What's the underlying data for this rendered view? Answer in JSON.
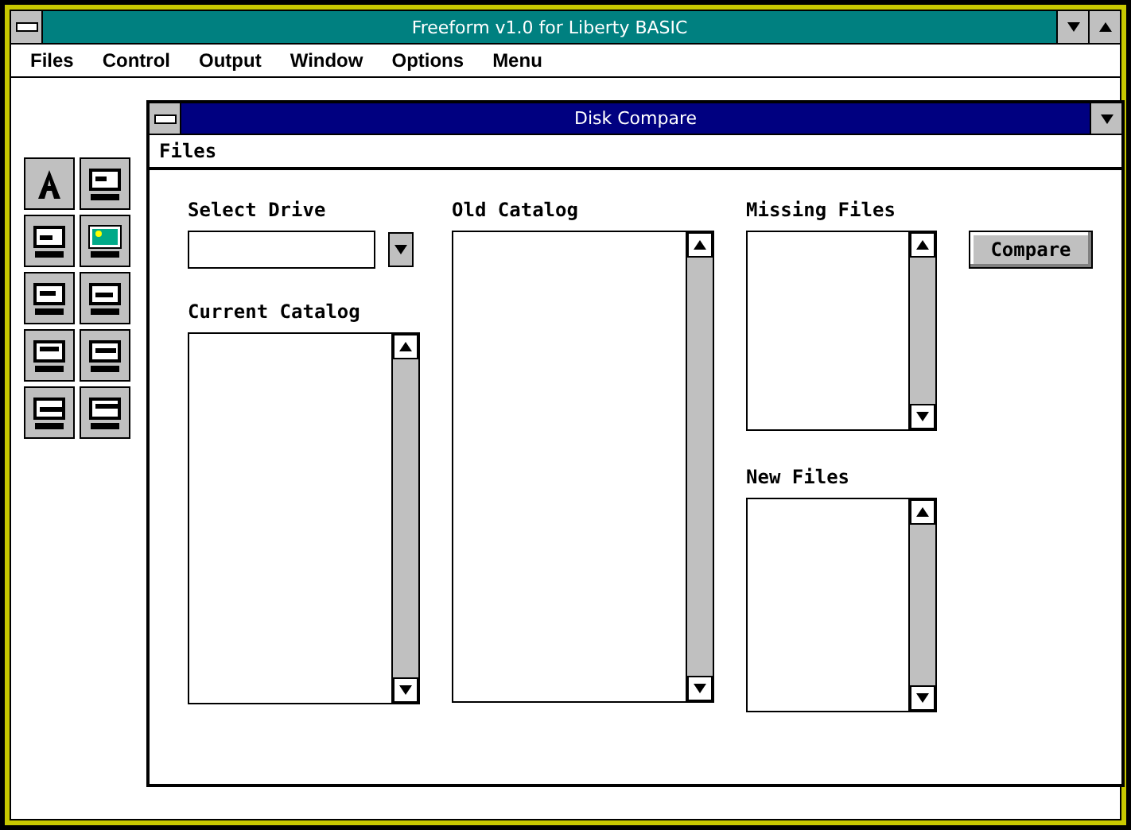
{
  "window": {
    "title": "Freeform v1.0 for Liberty BASIC"
  },
  "menu": [
    {
      "label": "Files"
    },
    {
      "label": "Control"
    },
    {
      "label": "Output"
    },
    {
      "label": "Window"
    },
    {
      "label": "Options"
    },
    {
      "label": "Menu"
    }
  ],
  "dialog": {
    "title": "Disk Compare",
    "menu": [
      {
        "label": "Files"
      }
    ],
    "select_drive": {
      "label": "Select Drive"
    },
    "current_catalog": {
      "label": "Current Catalog"
    },
    "old_catalog": {
      "label": "Old Catalog"
    },
    "missing_files": {
      "label": "Missing Files"
    },
    "new_files": {
      "label": "New Files"
    },
    "compare_button": "Compare"
  }
}
